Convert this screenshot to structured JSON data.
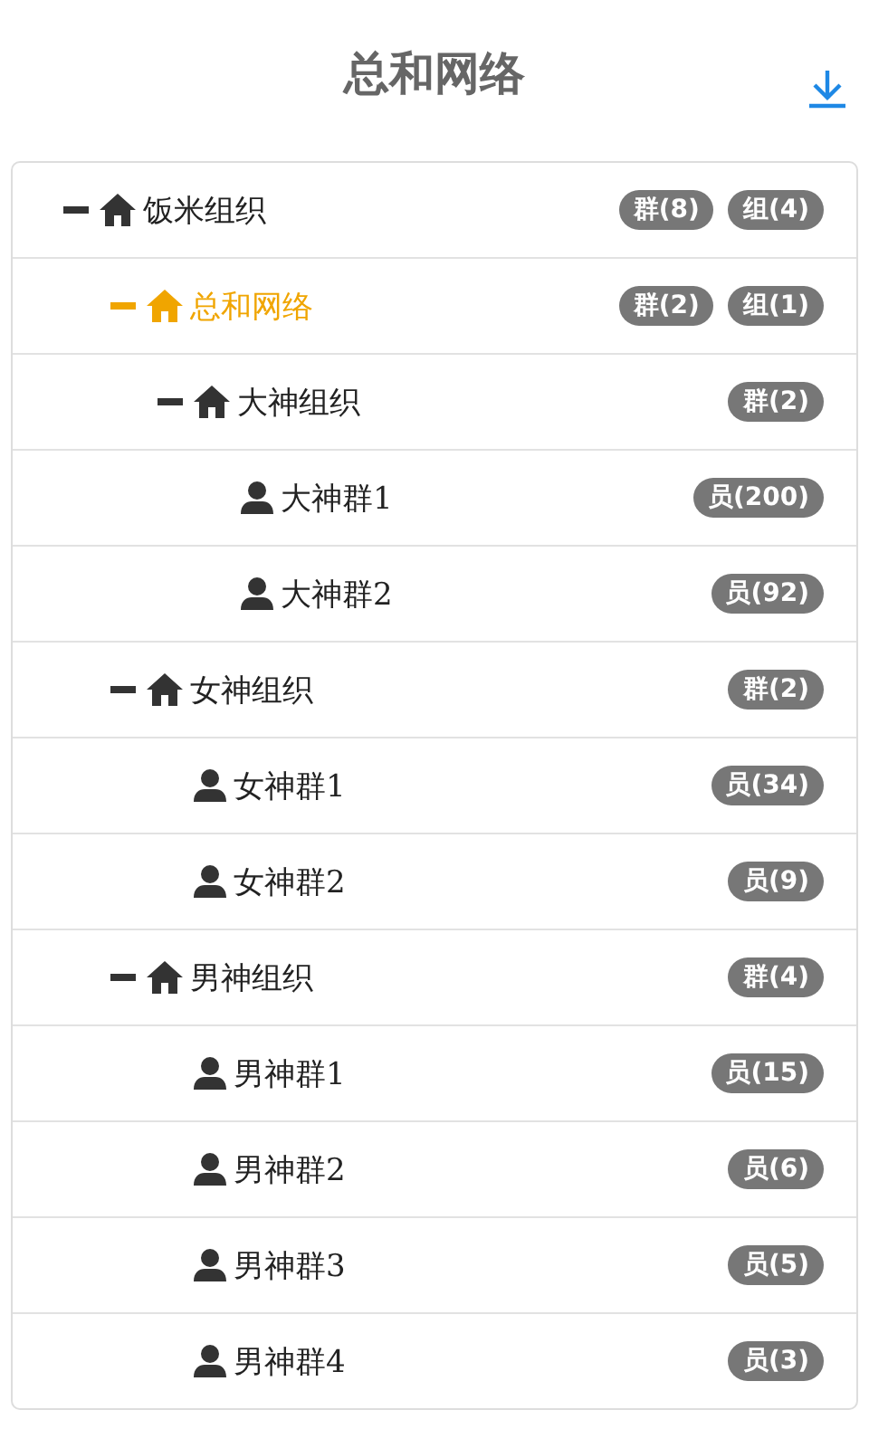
{
  "header": {
    "title": "总和网络"
  },
  "tree": [
    {
      "kind": "org",
      "label": "饭米组织",
      "expanded": true,
      "selected": false,
      "badges": [
        "群(8)",
        "组(4)"
      ],
      "children": [
        {
          "kind": "org",
          "label": "总和网络",
          "expanded": true,
          "selected": true,
          "badges": [
            "群(2)",
            "组(1)"
          ],
          "children": [
            {
              "kind": "org",
              "label": "大神组织",
              "expanded": true,
              "selected": false,
              "badges": [
                "群(2)"
              ],
              "children": [
                {
                  "kind": "group",
                  "label": "大神群1",
                  "selected": false,
                  "badges": [
                    "员(200)"
                  ]
                },
                {
                  "kind": "group",
                  "label": "大神群2",
                  "selected": false,
                  "badges": [
                    "员(92)"
                  ]
                }
              ]
            }
          ]
        },
        {
          "kind": "org",
          "label": "女神组织",
          "expanded": true,
          "selected": false,
          "badges": [
            "群(2)"
          ],
          "children": [
            {
              "kind": "group",
              "label": "女神群1",
              "selected": false,
              "badges": [
                "员(34)"
              ]
            },
            {
              "kind": "group",
              "label": "女神群2",
              "selected": false,
              "badges": [
                "员(9)"
              ]
            }
          ]
        },
        {
          "kind": "org",
          "label": "男神组织",
          "expanded": true,
          "selected": false,
          "badges": [
            "群(4)"
          ],
          "children": [
            {
              "kind": "group",
              "label": "男神群1",
              "selected": false,
              "badges": [
                "员(15)"
              ]
            },
            {
              "kind": "group",
              "label": "男神群2",
              "selected": false,
              "badges": [
                "员(6)"
              ]
            },
            {
              "kind": "group",
              "label": "男神群3",
              "selected": false,
              "badges": [
                "员(5)"
              ]
            },
            {
              "kind": "group",
              "label": "男神群4",
              "selected": false,
              "badges": [
                "员(3)"
              ]
            }
          ]
        }
      ]
    }
  ]
}
